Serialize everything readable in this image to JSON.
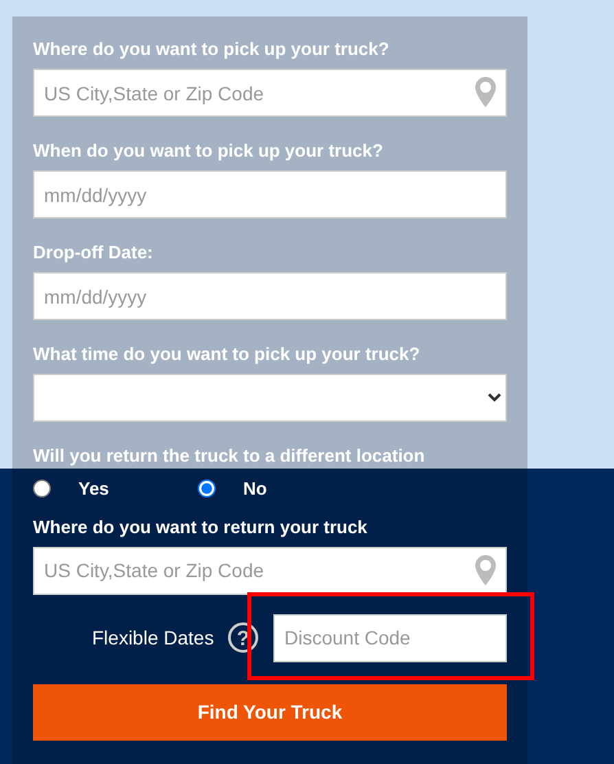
{
  "form": {
    "fields": [
      {
        "kind": "location",
        "label": "Where do you want to pick up your truck?",
        "placeholder": "US City,State or Zip Code"
      },
      {
        "kind": "text",
        "label": "When do you want to pick up your truck?",
        "placeholder": "mm/dd/yyyy"
      },
      {
        "kind": "text",
        "label": "Drop-off Date:",
        "placeholder": "mm/dd/yyyy"
      },
      {
        "kind": "select",
        "label": "What time do you want to pick up your truck?"
      },
      {
        "kind": "radio",
        "label": "Will you return the truck to a different location",
        "options": [
          {
            "label": "Yes",
            "selected": false
          },
          {
            "label": "No",
            "selected": true
          }
        ]
      },
      {
        "kind": "location",
        "label": "Where do you want to return your truck",
        "placeholder": "US City,State or Zip Code"
      }
    ],
    "flexible_dates": {
      "label": "Flexible Dates",
      "help": "?"
    },
    "discount": {
      "placeholder": "Discount Code",
      "highlighted": true
    },
    "submit": "Find Your Truck"
  }
}
